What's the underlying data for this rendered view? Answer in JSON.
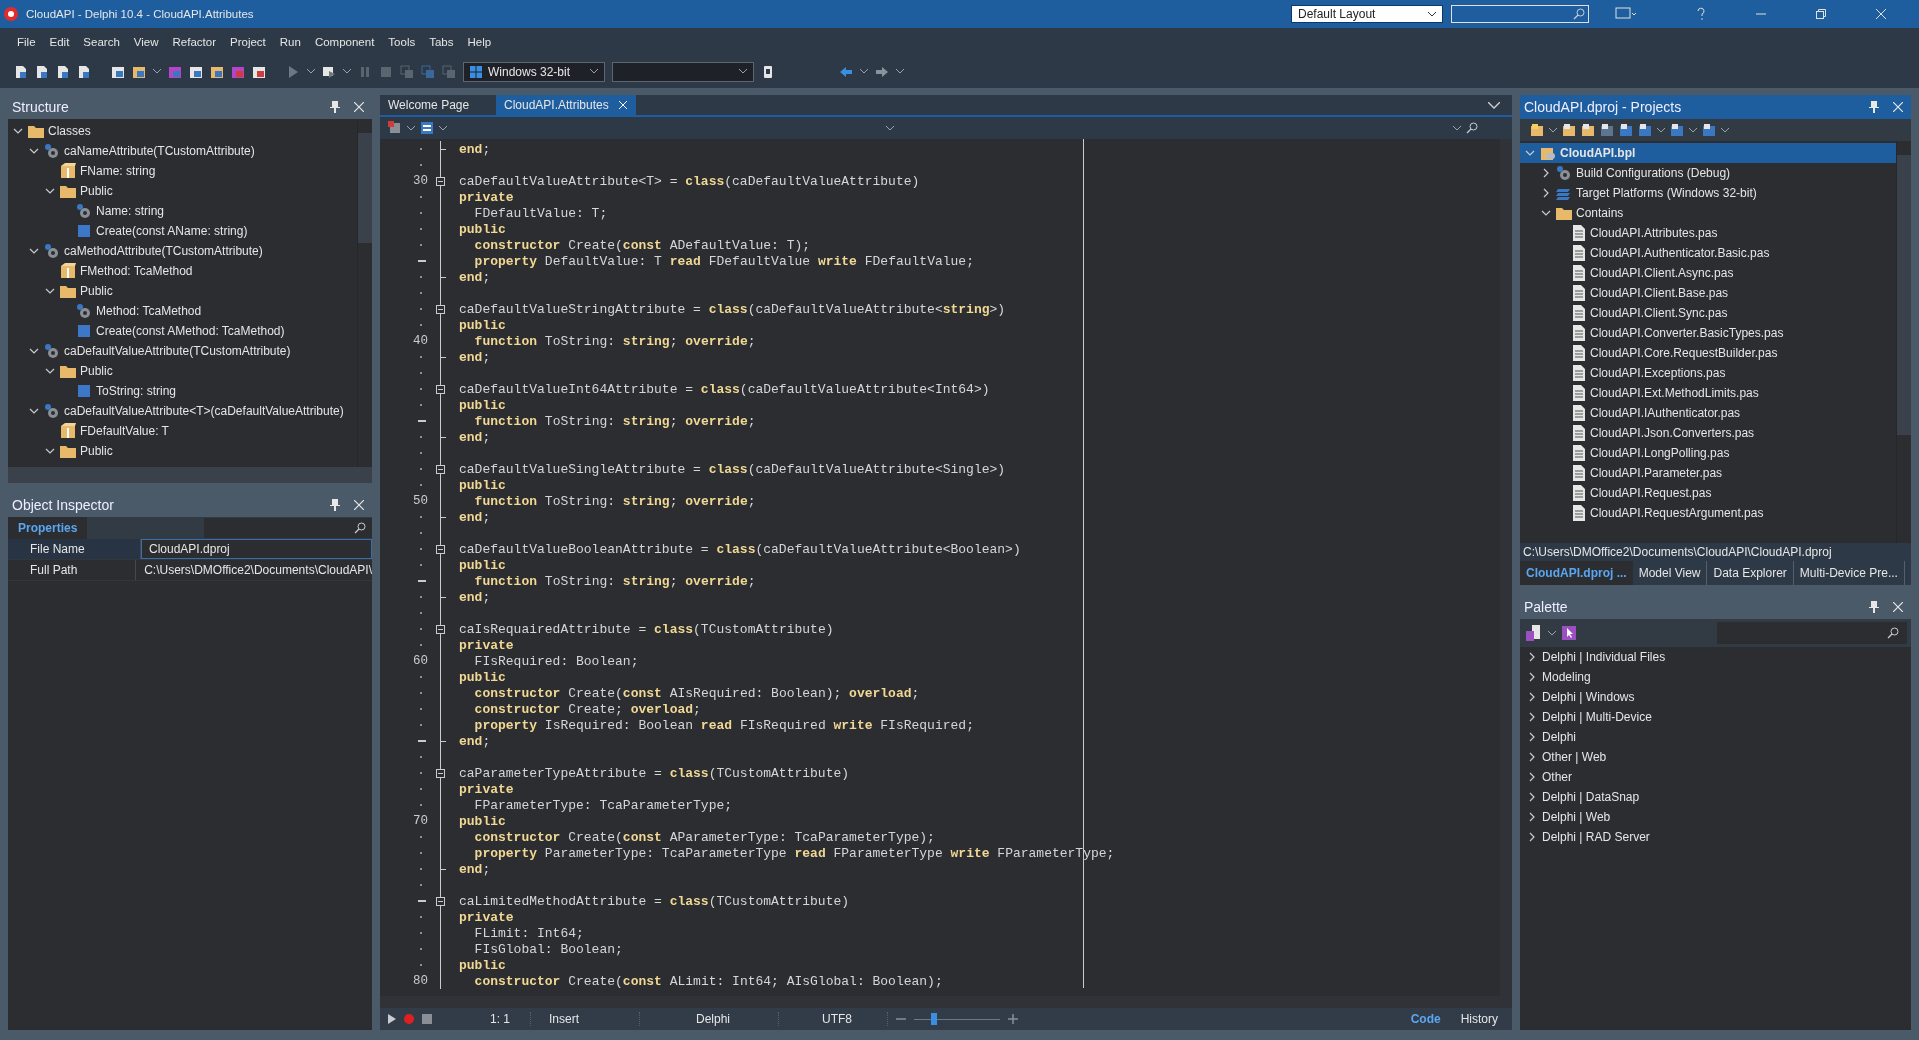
{
  "window": {
    "title": "CloudAPI - Delphi 10.4 - CloudAPI.Attributes",
    "layout": "Default Layout"
  },
  "menu": [
    "File",
    "Edit",
    "Search",
    "View",
    "Refactor",
    "Project",
    "Run",
    "Component",
    "Tools",
    "Tabs",
    "Help"
  ],
  "toolbar": {
    "platform": "Windows 32-bit"
  },
  "structure": {
    "title": "Structure",
    "tree": [
      {
        "label": "Classes",
        "kind": "folder",
        "expanded": true,
        "children": [
          {
            "label": "caNameAttribute(TCustomAttribute)",
            "kind": "class",
            "expanded": true,
            "children": [
              {
                "label": "FName: string",
                "kind": "field"
              },
              {
                "label": "Public",
                "kind": "folder",
                "expanded": true,
                "children": [
                  {
                    "label": "Name: string",
                    "kind": "property"
                  },
                  {
                    "label": "Create(const AName: string)",
                    "kind": "method"
                  }
                ]
              }
            ]
          },
          {
            "label": "caMethodAttribute(TCustomAttribute)",
            "kind": "class",
            "expanded": true,
            "children": [
              {
                "label": "FMethod: TcaMethod",
                "kind": "field"
              },
              {
                "label": "Public",
                "kind": "folder",
                "expanded": true,
                "children": [
                  {
                    "label": "Method: TcaMethod",
                    "kind": "property"
                  },
                  {
                    "label": "Create(const AMethod: TcaMethod)",
                    "kind": "method"
                  }
                ]
              }
            ]
          },
          {
            "label": "caDefaultValueAttribute(TCustomAttribute)",
            "kind": "class",
            "expanded": true,
            "children": [
              {
                "label": "Public",
                "kind": "folder",
                "expanded": true,
                "children": [
                  {
                    "label": "ToString: string",
                    "kind": "method"
                  }
                ]
              }
            ]
          },
          {
            "label": "caDefaultValueAttribute<T>(caDefaultValueAttribute)",
            "kind": "class",
            "expanded": true,
            "children": [
              {
                "label": "FDefaultValue: T",
                "kind": "field"
              },
              {
                "label": "Public",
                "kind": "folder",
                "expanded": true
              }
            ]
          }
        ]
      }
    ]
  },
  "inspector": {
    "title": "Object Inspector",
    "tab": "Properties",
    "rows": [
      {
        "name": "File Name",
        "value": "CloudAPI.dproj",
        "selected": true
      },
      {
        "name": "Full Path",
        "value": "C:\\Users\\DMOffice2\\Documents\\CloudAPI\\",
        "selected": false
      }
    ]
  },
  "editor": {
    "tabs": [
      {
        "label": "Welcome Page",
        "selected": false
      },
      {
        "label": "CloudAPI.Attributes",
        "selected": true
      }
    ],
    "lines": [
      {
        "text": "**end**;",
        "fold_start": false,
        "fold_end": true,
        "modified": false
      },
      {
        "fold_start": false,
        "fold_end": false,
        "modified": false
      },
      {
        "number": "30",
        "text": "caDefaultValueAttribute<T> = **class**(caDefaultValueAttribute)",
        "fold_start": true,
        "fold_end": false,
        "modified": false
      },
      {
        "kind": "section",
        "text": "private",
        "fold_start": false,
        "fold_end": false,
        "modified": false
      },
      {
        "text": "  FDefaultValue: T;",
        "fold_start": false,
        "fold_end": false,
        "modified": false
      },
      {
        "kind": "section",
        "text": "public",
        "fold_start": false,
        "fold_end": false,
        "modified": false
      },
      {
        "text": "  **constructor** Create(**const** ADefaultValue: T);",
        "fold_start": false,
        "fold_end": false,
        "modified": false
      },
      {
        "text": "  **property** DefaultValue: T **read** FDefaultValue **write** FDefaultValue;",
        "fold_start": false,
        "fold_end": false,
        "modified": true
      },
      {
        "text": "**end**;",
        "fold_start": false,
        "fold_end": true,
        "modified": false
      },
      {
        "fold_start": false,
        "fold_end": false,
        "modified": false
      },
      {
        "text": "caDefaultValueStringAttribute = **class**(caDefaultValueAttribute<**string**>)",
        "fold_start": true,
        "fold_end": false,
        "modified": false
      },
      {
        "kind": "section",
        "text": "public",
        "fold_start": false,
        "fold_end": false,
        "modified": false
      },
      {
        "number": "40",
        "text": "  **function** ToString: **string**; **override**;",
        "fold_start": false,
        "fold_end": false,
        "modified": false
      },
      {
        "text": "**end**;",
        "fold_start": false,
        "fold_end": true,
        "modified": false
      },
      {
        "fold_start": false,
        "fold_end": false,
        "modified": false
      },
      {
        "text": "caDefaultValueInt64Attribute = **class**(caDefaultValueAttribute<Int64>)",
        "fold_start": true,
        "fold_end": false,
        "modified": false
      },
      {
        "kind": "section",
        "text": "public",
        "fold_start": false,
        "fold_end": false,
        "modified": false
      },
      {
        "text": "  **function** ToString: **string**; **override**;",
        "fold_start": false,
        "fold_end": false,
        "modified": true
      },
      {
        "text": "**end**;",
        "fold_start": false,
        "fold_end": true,
        "modified": false
      },
      {
        "fold_start": false,
        "fold_end": false,
        "modified": false
      },
      {
        "text": "caDefaultValueSingleAttribute = **class**(caDefaultValueAttribute<Single>)",
        "fold_start": true,
        "fold_end": false,
        "modified": false
      },
      {
        "kind": "section",
        "text": "public",
        "fold_start": false,
        "fold_end": false,
        "modified": false
      },
      {
        "number": "50",
        "text": "  **function** ToString: **string**; **override**;",
        "fold_start": false,
        "fold_end": false,
        "modified": false
      },
      {
        "text": "**end**;",
        "fold_start": false,
        "fold_end": true,
        "modified": false
      },
      {
        "fold_start": false,
        "fold_end": false,
        "modified": false
      },
      {
        "text": "caDefaultValueBooleanAttribute = **class**(caDefaultValueAttribute<Boolean>)",
        "fold_start": true,
        "fold_end": false,
        "modified": false
      },
      {
        "kind": "section",
        "text": "public",
        "fold_start": false,
        "fold_end": false,
        "modified": false
      },
      {
        "text": "  **function** ToString: **string**; **override**;",
        "fold_start": false,
        "fold_end": false,
        "modified": true
      },
      {
        "text": "**end**;",
        "fold_start": false,
        "fold_end": true,
        "modified": false
      },
      {
        "fold_start": false,
        "fold_end": false,
        "modified": false
      },
      {
        "text": "caIsRequairedAttribute = **class**(TCustomAttribute)",
        "fold_start": true,
        "fold_end": false,
        "modified": false
      },
      {
        "kind": "section",
        "text": "private",
        "fold_start": false,
        "fold_end": false,
        "modified": false
      },
      {
        "number": "60",
        "text": "  FIsRequired: Boolean;",
        "fold_start": false,
        "fold_end": false,
        "modified": false
      },
      {
        "kind": "section",
        "text": "public",
        "fold_start": false,
        "fold_end": false,
        "modified": false
      },
      {
        "text": "  **constructor** Create(**const** AIsRequired: Boolean); **overload**;",
        "fold_start": false,
        "fold_end": false,
        "modified": false
      },
      {
        "text": "  **constructor** Create; **overload**;",
        "fold_start": false,
        "fold_end": false,
        "modified": false
      },
      {
        "text": "  **property** IsRequired: Boolean **read** FIsRequired **write** FIsRequired;",
        "fold_start": false,
        "fold_end": false,
        "modified": false
      },
      {
        "text": "**end**;",
        "fold_start": false,
        "fold_end": true,
        "modified": true
      },
      {
        "fold_start": false,
        "fold_end": false,
        "modified": false
      },
      {
        "text": "caParameterTypeAttribute = **class**(TCustomAttribute)",
        "fold_start": true,
        "fold_end": false,
        "modified": false
      },
      {
        "kind": "section",
        "text": "private",
        "fold_start": false,
        "fold_end": false,
        "modified": false
      },
      {
        "text": "  FParameterType: TcaParameterType;",
        "fold_start": false,
        "fold_end": false,
        "modified": false
      },
      {
        "number": "70",
        "kind": "section",
        "text": "public",
        "fold_start": false,
        "fold_end": false,
        "modified": false
      },
      {
        "text": "  **constructor** Create(**const** AParameterType: TcaParameterType);",
        "fold_start": false,
        "fold_end": false,
        "modified": false
      },
      {
        "text": "  **property** ParameterType: TcaParameterType **read** FParameterType **write** FParameterType;",
        "fold_start": false,
        "fold_end": false,
        "modified": false
      },
      {
        "text": "**end**;",
        "fold_start": false,
        "fold_end": true,
        "modified": false
      },
      {
        "fold_start": false,
        "fold_end": false,
        "modified": false
      },
      {
        "text": "caLimitedMethodAttribute = **class**(TCustomAttribute)",
        "fold_start": true,
        "fold_end": false,
        "modified": true
      },
      {
        "kind": "section",
        "text": "private",
        "fold_start": false,
        "fold_end": false,
        "modified": false
      },
      {
        "text": "  FLimit: Int64;",
        "fold_start": false,
        "fold_end": false,
        "modified": false
      },
      {
        "text": "  FIsGlobal: Boolean;",
        "fold_start": false,
        "fold_end": false,
        "modified": false
      },
      {
        "kind": "section",
        "text": "public",
        "fold_start": false,
        "fold_end": false,
        "modified": false
      },
      {
        "number": "80",
        "text": "  **constructor** Create(**const** ALimit: Int64; AIsGlobal: Boolean);",
        "fold_start": false,
        "fold_end": false,
        "modified": false
      }
    ],
    "status": {
      "position": "1: 1",
      "mode": "Insert",
      "language": "Delphi",
      "encoding": "UTF8",
      "zoom": {
        "level": 0.2
      }
    },
    "views": [
      {
        "label": "Code",
        "selected": true
      },
      {
        "label": "History",
        "selected": false
      }
    ]
  },
  "projects": {
    "title": "CloudAPI.dproj - Projects",
    "tree": [
      {
        "label": "CloudAPI.bpl",
        "kind": "project",
        "expanded": true,
        "selected": true,
        "children": [
          {
            "label": "Build Configurations (Debug)",
            "kind": "config",
            "expanded": false,
            "selected": false
          },
          {
            "label": "Target Platforms (Windows 32-bit)",
            "kind": "platforms",
            "expanded": false,
            "selected": false
          },
          {
            "label": "Contains",
            "kind": "folder",
            "expanded": true,
            "selected": false,
            "children": [
              {
                "label": "CloudAPI.Attributes.pas",
                "kind": "file",
                "selected": false
              },
              {
                "label": "CloudAPI.Authenticator.Basic.pas",
                "kind": "file",
                "selected": false
              },
              {
                "label": "CloudAPI.Client.Async.pas",
                "kind": "file",
                "selected": false
              },
              {
                "label": "CloudAPI.Client.Base.pas",
                "kind": "file",
                "selected": false
              },
              {
                "label": "CloudAPI.Client.Sync.pas",
                "kind": "file",
                "selected": false
              },
              {
                "label": "CloudAPI.Converter.BasicTypes.pas",
                "kind": "file",
                "selected": false
              },
              {
                "label": "CloudAPI.Core.RequestBuilder.pas",
                "kind": "file",
                "selected": false
              },
              {
                "label": "CloudAPI.Exceptions.pas",
                "kind": "file",
                "selected": false
              },
              {
                "label": "CloudAPI.Ext.MethodLimits.pas",
                "kind": "file",
                "selected": false
              },
              {
                "label": "CloudAPI.IAuthenticator.pas",
                "kind": "file",
                "selected": false
              },
              {
                "label": "CloudAPI.Json.Converters.pas",
                "kind": "file",
                "selected": false
              },
              {
                "label": "CloudAPI.LongPolling.pas",
                "kind": "file",
                "selected": false
              },
              {
                "label": "CloudAPI.Parameter.pas",
                "kind": "file",
                "selected": false
              },
              {
                "label": "CloudAPI.Request.pas",
                "kind": "file",
                "selected": false
              },
              {
                "label": "CloudAPI.RequestArgument.pas",
                "kind": "file",
                "selected": false
              }
            ]
          }
        ]
      }
    ],
    "path": "C:\\Users\\DMOffice2\\Documents\\CloudAPI\\CloudAPI.dproj",
    "tabs": [
      {
        "label": "CloudAPI.dproj ...",
        "selected": true
      },
      {
        "label": "Model View",
        "selected": false
      },
      {
        "label": "Data Explorer",
        "selected": false
      },
      {
        "label": "Multi-Device Pre...",
        "selected": false
      }
    ]
  },
  "palette": {
    "title": "Palette",
    "categories": [
      "Delphi | Individual Files",
      "Modeling",
      "Delphi | Windows",
      "Delphi | Multi-Device",
      "Delphi",
      "Other | Web",
      "Other",
      "Delphi | DataSnap",
      "Delphi | Web",
      "Delphi | RAD Server"
    ]
  }
}
